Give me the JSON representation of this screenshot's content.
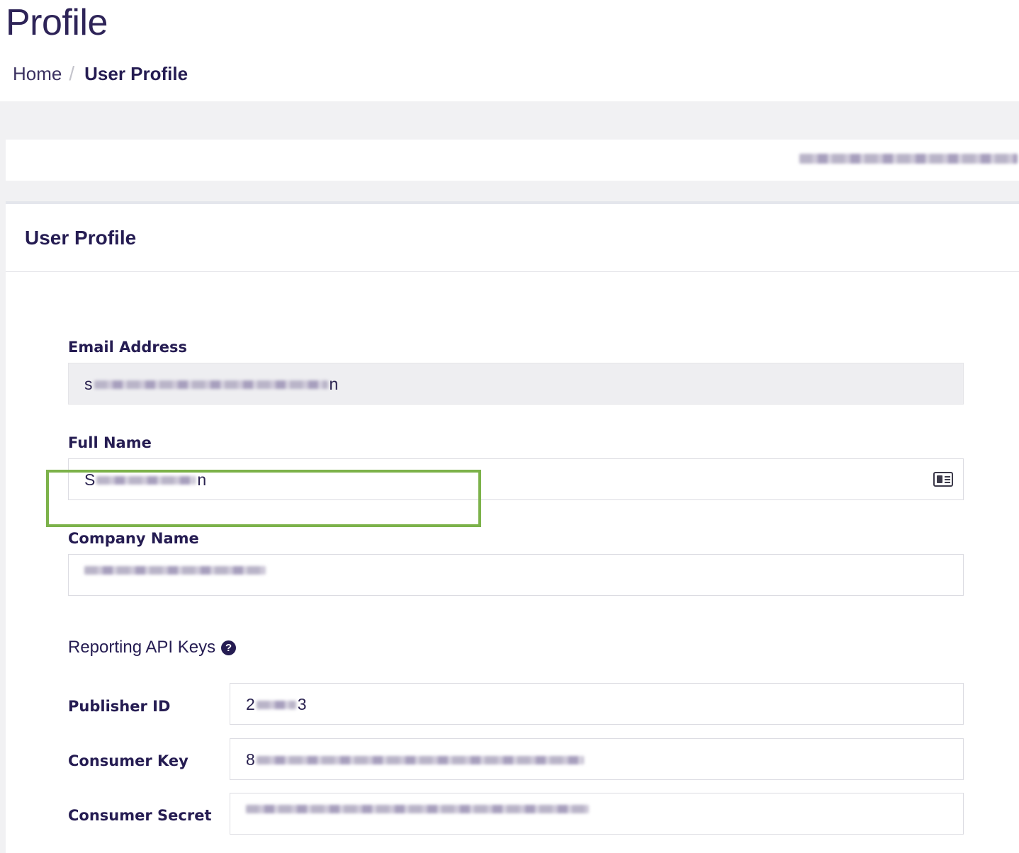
{
  "header": {
    "title": "Profile"
  },
  "breadcrumb": {
    "home": "Home",
    "separator": "/",
    "current": "User Profile"
  },
  "user_bar": {
    "username_redacted": ""
  },
  "panel": {
    "title": "User Profile"
  },
  "form": {
    "email": {
      "label": "Email Address",
      "value_start": "s",
      "value_end": "n"
    },
    "full_name": {
      "label": "Full Name",
      "value_start": "S",
      "value_end": "n"
    },
    "company": {
      "label": "Company Name",
      "value_start": "",
      "value_end": ""
    }
  },
  "api_keys": {
    "title": "Reporting API Keys",
    "help": "?",
    "publisher_id": {
      "label": "Publisher ID",
      "value_start": "2",
      "value_end": "3"
    },
    "consumer_key": {
      "label": "Consumer Key",
      "value_start": "8",
      "value_end": ""
    },
    "consumer_secret": {
      "label": "Consumer Secret",
      "value_start": "",
      "value_end": ""
    }
  },
  "colors": {
    "highlight": "#7cb24a",
    "text_primary": "#251c52",
    "band": "#f1f1f3"
  },
  "icons": {
    "full_name_field": "contact-card-icon",
    "api_keys_help": "question-circle-icon"
  }
}
